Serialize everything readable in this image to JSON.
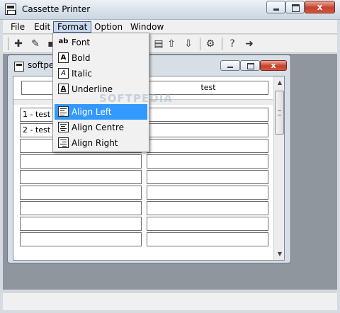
{
  "window": {
    "title": "Cassette Printer",
    "close_glyph": "x"
  },
  "menubar": {
    "items": [
      "File",
      "Edit",
      "Format",
      "Option",
      "Window"
    ]
  },
  "toolbar": {
    "icons": [
      "new-icon",
      "open-icon",
      "save-icon",
      "print-icon",
      "arrow-up-icon",
      "arrow-down-icon",
      "settings-icon",
      "help-icon",
      "exit-icon"
    ]
  },
  "child": {
    "title": "softpe",
    "close_glyph": "x",
    "header": {
      "left": "",
      "right": "test"
    },
    "rows": [
      {
        "left": "1 - test",
        "right": ""
      },
      {
        "left": "2 - test",
        "right": ""
      },
      {
        "left": "",
        "right": ""
      },
      {
        "left": "",
        "right": ""
      },
      {
        "left": "",
        "right": ""
      },
      {
        "left": "",
        "right": ""
      },
      {
        "left": "",
        "right": ""
      },
      {
        "left": "",
        "right": ""
      },
      {
        "left": "",
        "right": ""
      }
    ]
  },
  "format_menu": {
    "items": [
      {
        "label": "Font",
        "icon": "font-icon",
        "glyph": "ab"
      },
      {
        "label": "Bold",
        "icon": "bold-icon",
        "glyph": "A"
      },
      {
        "label": "Italic",
        "icon": "italic-icon",
        "glyph": "A"
      },
      {
        "label": "Underline",
        "icon": "underline-icon",
        "glyph": "A"
      },
      {
        "label": "Align Left",
        "icon": "align-left-icon",
        "highlighted": true
      },
      {
        "label": "Align Centre",
        "icon": "align-centre-icon"
      },
      {
        "label": "Align Right",
        "icon": "align-right-icon"
      }
    ]
  },
  "watermark": "SOFTPEDIA",
  "colors": {
    "highlight": "#3399ff",
    "close_button": "#c6412c"
  }
}
